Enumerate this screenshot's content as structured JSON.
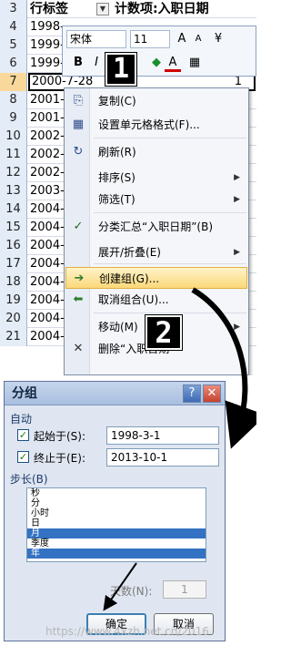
{
  "sheet": {
    "header": {
      "row": "3",
      "col_a": "行标签",
      "col_b": "计数项:入职日期"
    },
    "rows": [
      {
        "num": "4",
        "a": "1998-"
      },
      {
        "num": "5",
        "a": "1999-"
      },
      {
        "num": "6",
        "a": "1999-"
      },
      {
        "num": "7",
        "a": "2000-7-28",
        "b": "1"
      },
      {
        "num": "8",
        "a": "2001-"
      },
      {
        "num": "9",
        "a": "2001-"
      },
      {
        "num": "10",
        "a": "2002-"
      },
      {
        "num": "11",
        "a": "2002-"
      },
      {
        "num": "12",
        "a": "2002-"
      },
      {
        "num": "13",
        "a": "2003-"
      },
      {
        "num": "14",
        "a": "2004-"
      },
      {
        "num": "15",
        "a": "2004-"
      },
      {
        "num": "16",
        "a": "2004-"
      },
      {
        "num": "17",
        "a": "2004-"
      },
      {
        "num": "18",
        "a": "2004-"
      },
      {
        "num": "19",
        "a": "2004-"
      },
      {
        "num": "20",
        "a": "2004-"
      },
      {
        "num": "21",
        "a": "2004-"
      }
    ]
  },
  "minibar": {
    "font": "宋体",
    "size": "11",
    "grow": "A",
    "shrink": "A",
    "bold": "B",
    "italic": "I",
    "font_color": "A"
  },
  "context_menu": {
    "items": [
      {
        "label": "复制(C)",
        "icon": "copy-icon",
        "glyph": "⎘"
      },
      {
        "label": "设置单元格格式(F)...",
        "icon": "format-cells-icon",
        "glyph": "▦"
      },
      {
        "label": "刷新(R)",
        "icon": "refresh-icon",
        "glyph": "↻"
      },
      {
        "label": "排序(S)",
        "submenu": "▶"
      },
      {
        "label": "筛选(T)",
        "submenu": "▶"
      },
      {
        "label": "分类汇总“入职日期”(B)",
        "icon": "check-icon",
        "glyph": "✓"
      },
      {
        "label": "展开/折叠(E)",
        "submenu": "▶"
      },
      {
        "label": "创建组(G)...",
        "icon": "group-arrow-icon",
        "glyph": "➔"
      },
      {
        "label": "取消组合(U)...",
        "icon": "ungroup-arrow-icon",
        "glyph": "⬅"
      },
      {
        "label": "移动(M)",
        "submenu": "▶"
      },
      {
        "label": "删除“入职日期”",
        "icon": "delete-icon",
        "glyph": "✕"
      }
    ]
  },
  "badges": {
    "step1": "1",
    "step2": "2",
    "step3": "3"
  },
  "dialog": {
    "title": "分组",
    "help": "?",
    "close": "✕",
    "auto_label": "自动",
    "start_label": "起始于(S):",
    "start_value": "1998-3-1",
    "end_label": "终止于(E):",
    "end_value": "2013-10-1",
    "step_label": "步长(B)",
    "options": [
      "秒",
      "分",
      "小时",
      "日",
      "月",
      "季度",
      "年"
    ],
    "selected": [
      "月",
      "年"
    ],
    "days_label": "天数(N):",
    "days_value": "1",
    "ok": "确定",
    "cancel": "取消"
  },
  "watermark": "https://www.4xzh.net.cn/2016"
}
